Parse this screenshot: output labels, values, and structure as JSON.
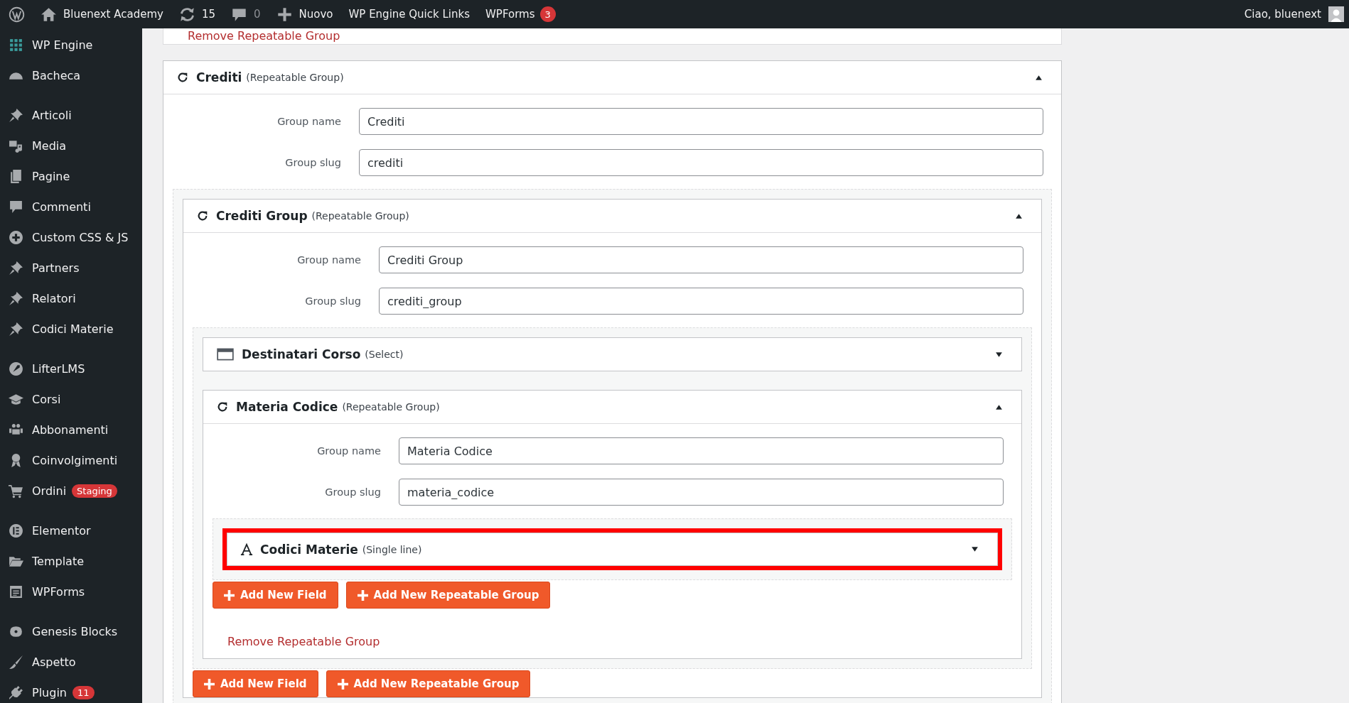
{
  "admin_bar": {
    "site": "Bluenext Academy",
    "updates": "15",
    "comments": "0",
    "new": "Nuovo",
    "links": [
      "WP Engine Quick Links"
    ],
    "wpforms": {
      "label": "WPForms",
      "badge": "3"
    },
    "greeting": "Ciao, bluenext"
  },
  "sidebar": {
    "groups": [
      {
        "items": [
          {
            "label": "WP Engine"
          },
          {
            "label": "Bacheca"
          }
        ]
      },
      {
        "items": [
          {
            "label": "Articoli"
          },
          {
            "label": "Media"
          },
          {
            "label": "Pagine"
          },
          {
            "label": "Commenti"
          },
          {
            "label": "Custom CSS & JS"
          },
          {
            "label": "Partners"
          },
          {
            "label": "Relatori"
          },
          {
            "label": "Codici Materie"
          }
        ]
      },
      {
        "items": [
          {
            "label": "LifterLMS"
          },
          {
            "label": "Corsi"
          },
          {
            "label": "Abbonamenti"
          },
          {
            "label": "Coinvolgimenti"
          },
          {
            "label": "Ordini",
            "badge": "Staging"
          }
        ]
      },
      {
        "items": [
          {
            "label": "Elementor"
          },
          {
            "label": "Template"
          },
          {
            "label": "WPForms"
          }
        ]
      },
      {
        "items": [
          {
            "label": "Genesis Blocks"
          },
          {
            "label": "Aspetto"
          },
          {
            "label": "Plugin",
            "badge": "11"
          }
        ]
      }
    ]
  },
  "top_remove_link": "Remove Repeatable Group",
  "group": {
    "kind": "repeatable",
    "title": "Crediti",
    "type": "(Repeatable Group)",
    "expanded": true,
    "fields": [
      {
        "label": "Group name",
        "value": "Crediti"
      },
      {
        "label": "Group slug",
        "value": "crediti"
      }
    ],
    "children": [
      {
        "kind": "repeatable",
        "title": "Crediti Group",
        "type": "(Repeatable Group)",
        "expanded": true,
        "fields": [
          {
            "label": "Group name",
            "value": "Crediti Group"
          },
          {
            "label": "Group slug",
            "value": "crediti_group"
          }
        ],
        "children": [
          {
            "kind": "select",
            "title": "Destinatari Corso",
            "type": "(Select)",
            "expanded": false
          },
          {
            "kind": "repeatable",
            "title": "Materia Codice",
            "type": "(Repeatable Group)",
            "expanded": true,
            "fields": [
              {
                "label": "Group name",
                "value": "Materia Codice"
              },
              {
                "label": "Group slug",
                "value": "materia_codice"
              }
            ],
            "children": [
              {
                "kind": "text",
                "title": "Codici Materie",
                "type": "(Single line)",
                "expanded": false,
                "highlighted": true
              }
            ],
            "buttons": [
              "Add New Field",
              "Add New Repeatable Group"
            ],
            "remove_link": "Remove Repeatable Group"
          }
        ],
        "buttons": [
          "Add New Field",
          "Add New Repeatable Group"
        ]
      }
    ]
  }
}
